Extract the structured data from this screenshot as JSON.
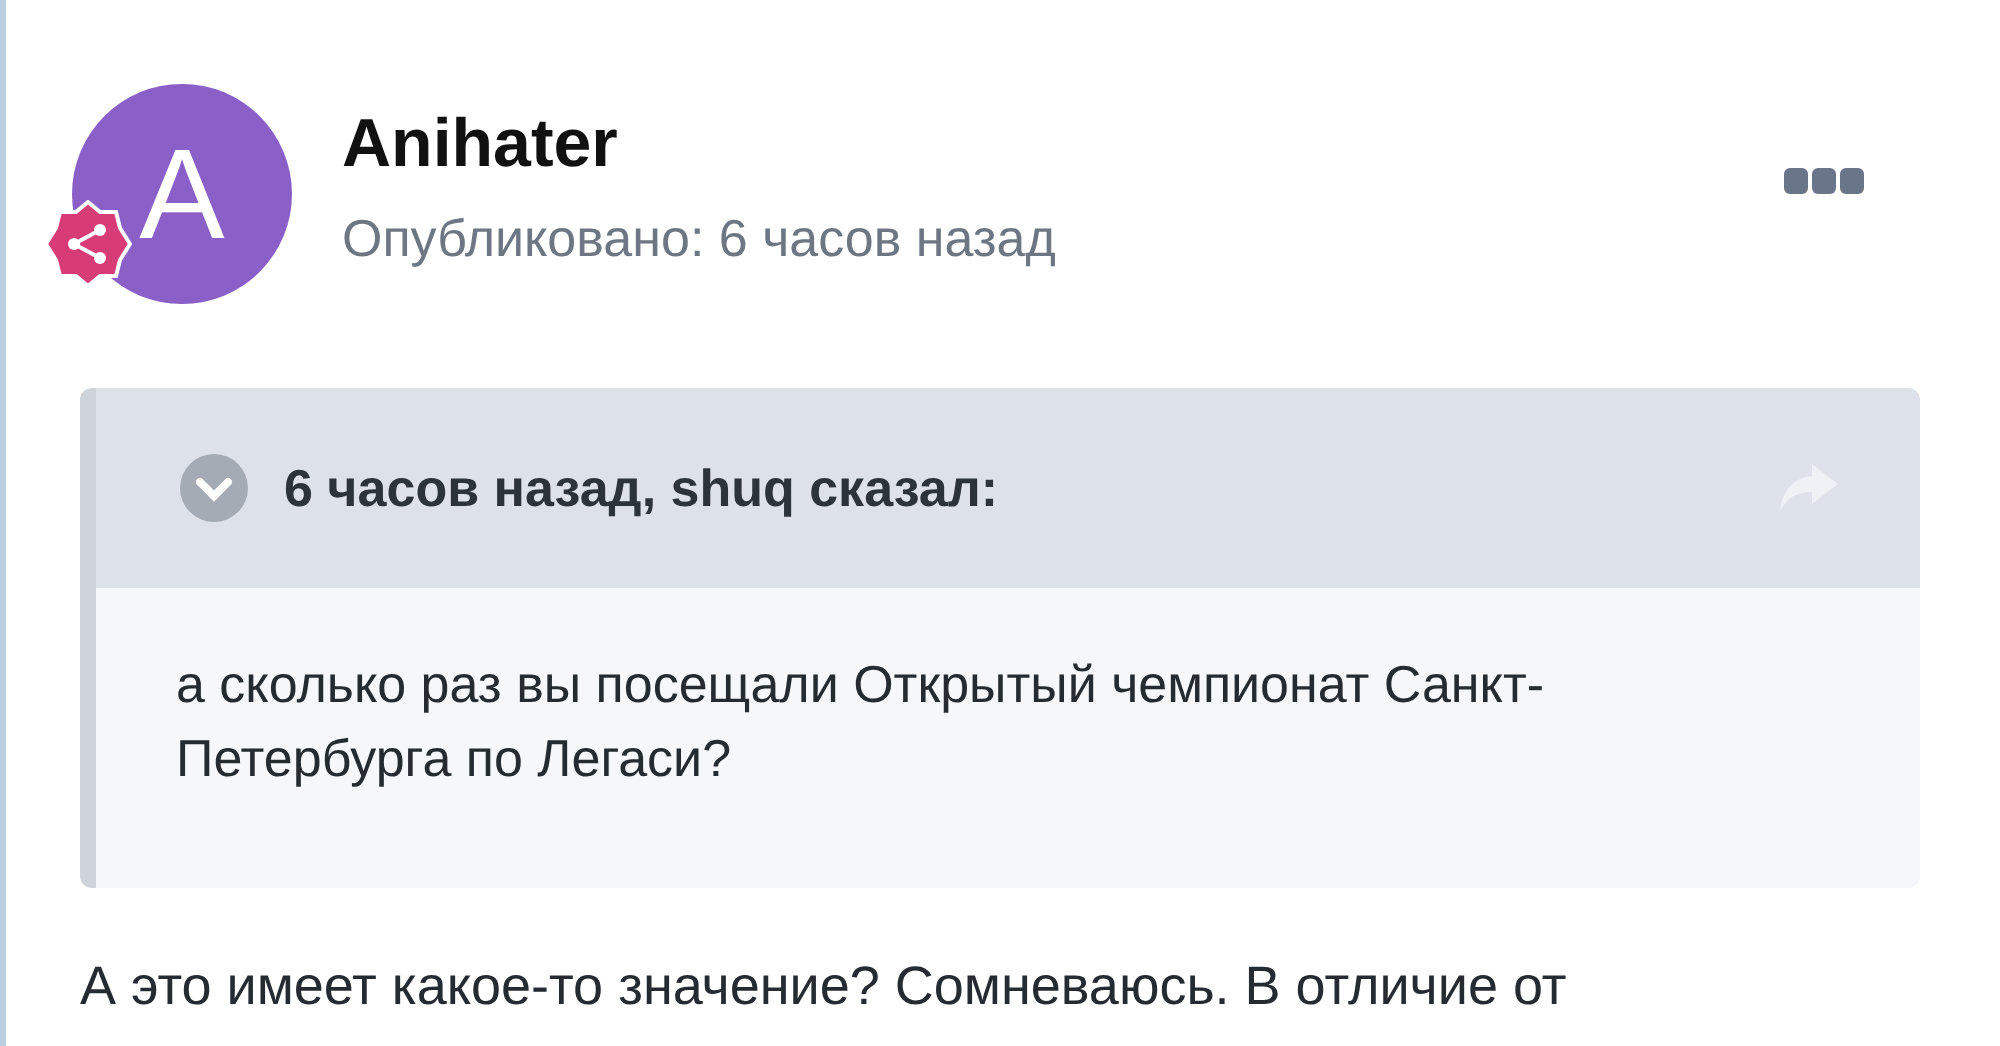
{
  "post": {
    "author": {
      "name": "Anihater",
      "initial": "A"
    },
    "published": "Опубликовано: 6 часов назад",
    "quote": {
      "header": "6 часов назад, shuq сказал:",
      "text": "а сколько раз вы посещали Открытый чемпионат Санкт-Петербурга по Легаси?"
    },
    "body": "А это имеет какое-то значение? Сомневаюсь. В отличие от"
  }
}
